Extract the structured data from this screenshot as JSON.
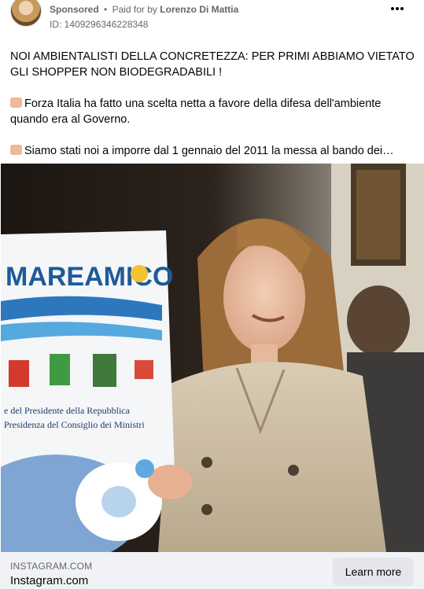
{
  "post": {
    "sponsored_label": "Sponsored",
    "separator": "•",
    "paid_prefix": "Paid for by",
    "payer_name": "Lorenzo Di Mattia",
    "ad_id": "ID: 1409296346228348",
    "paragraphs": [
      "NOI AMBIENTALISTI DELLA CONCRETEZZA: PER PRIMI ABBIAMO VIETATO GLI SHOPPER NON BIODEGRADABILI !",
      "Forza Italia ha fatto una scelta netta a favore della difesa dell'ambiente quando era al Governo.",
      "Siamo stati noi a imporre dal 1 gennaio del 2011 la messa al bando dei…"
    ]
  },
  "image": {
    "banner_brand": "MAREAMICO",
    "banner_text_line1": "e del Presidente della Repubblica",
    "banner_text_line2": "Presidenza del Consiglio dei Ministri"
  },
  "link": {
    "domain": "INSTAGRAM.COM",
    "title": "Instagram.com",
    "cta_label": "Learn more"
  },
  "icons": {
    "avatar": "profile-avatar",
    "more": "more-horizontal-icon",
    "emoji": "hand-pointing-icon"
  }
}
